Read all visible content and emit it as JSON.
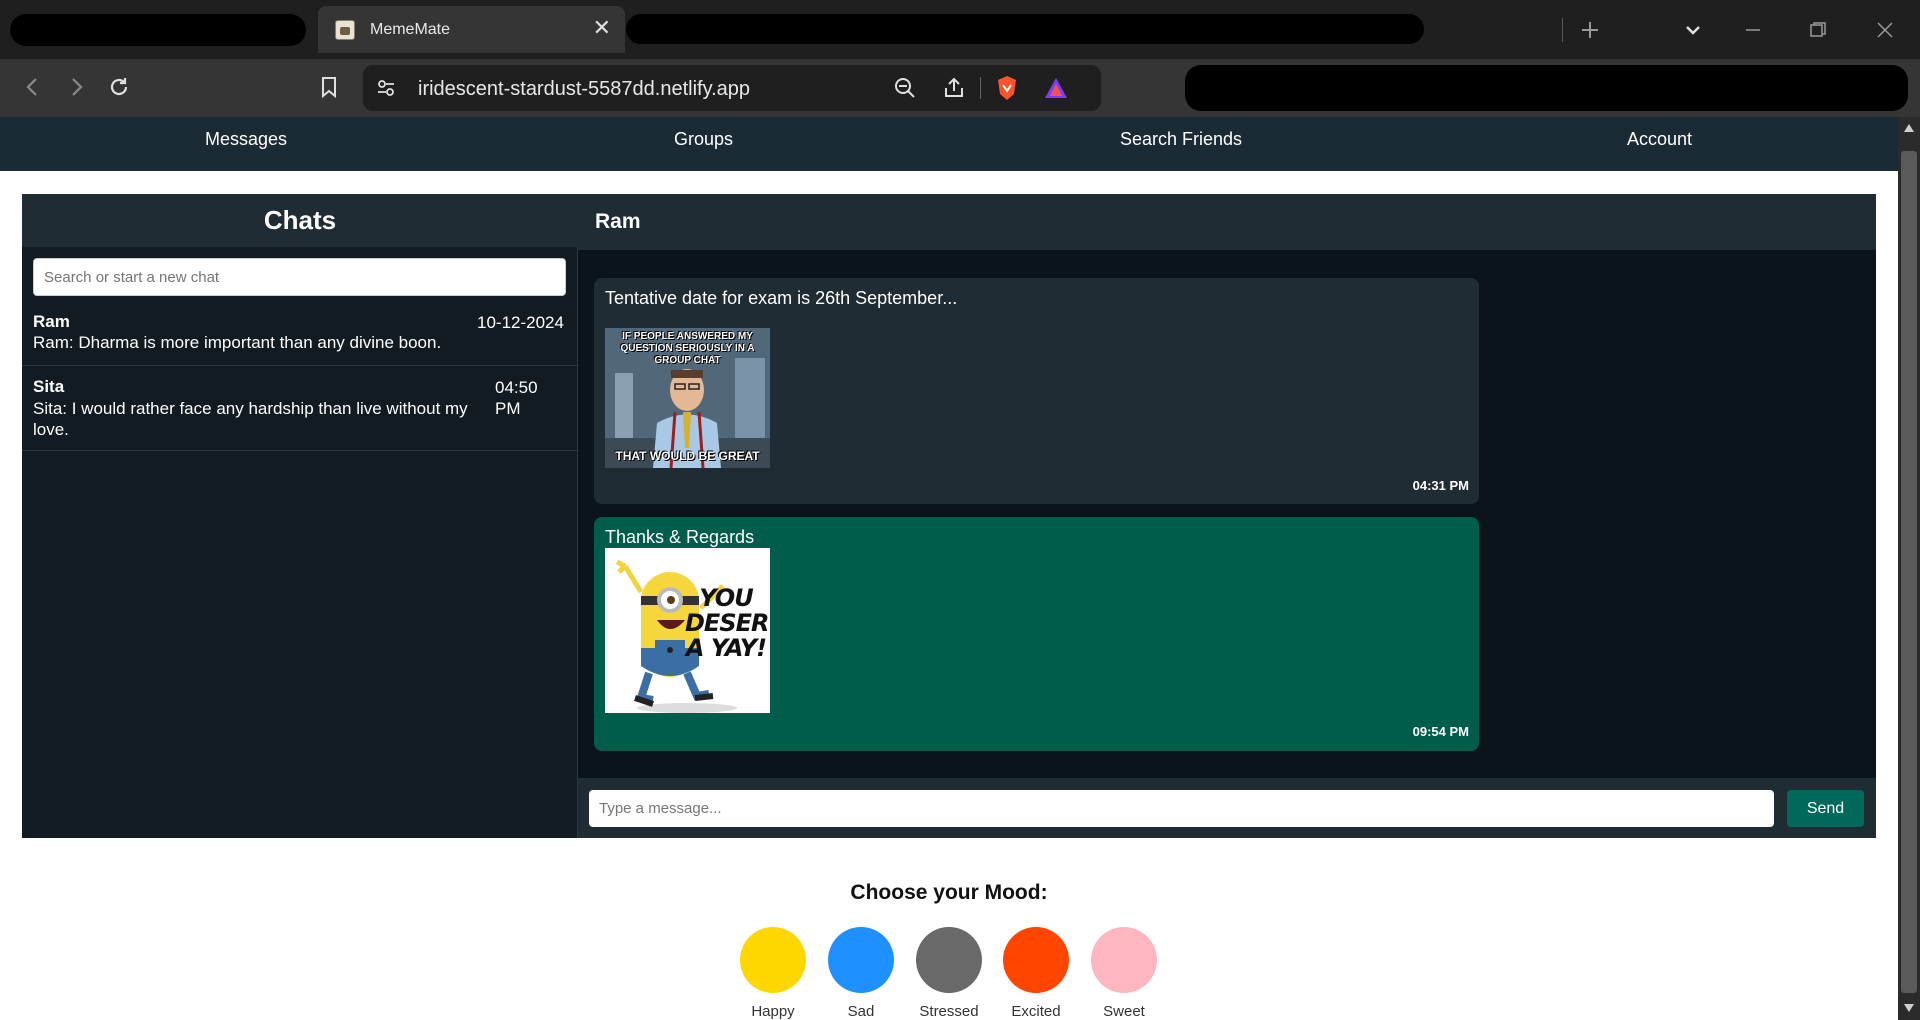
{
  "browser": {
    "tab_title": "MemeMate",
    "tab_close": "✕",
    "url": "iridescent-stardust-5587dd.netlify.app"
  },
  "nav": {
    "items": [
      "Messages",
      "Groups",
      "Search Friends",
      "Account"
    ]
  },
  "sidebar": {
    "title": "Chats",
    "search_placeholder": "Search or start a new chat",
    "chats": [
      {
        "name": "Ram",
        "preview": "Ram: Dharma is more important than any divine boon.",
        "time": "10-12-2024"
      },
      {
        "name": "Sita",
        "preview": "Sita: I would rather face any hardship than live without my love.",
        "time": "04:50 PM"
      }
    ]
  },
  "conversation": {
    "title": "Ram",
    "messages": [
      {
        "text": "Tentative date for exam is 26th September...",
        "meme_top": "IF PEOPLE ANSWERED MY QUESTION SERIOUSLY IN A GROUP CHAT",
        "meme_bottom": "THAT WOULD BE GREAT",
        "time": "04:31 PM",
        "color": "#202c33"
      },
      {
        "text": "Thanks & Regards",
        "meme_caption": "YOU DESERVE A YAY!",
        "time": "09:54 PM",
        "color": "#005c4b"
      }
    ],
    "input_placeholder": "Type a message...",
    "send_label": "Send"
  },
  "mood": {
    "title": "Choose your Mood:",
    "options": [
      {
        "label": "Happy",
        "color": "#ffd700"
      },
      {
        "label": "Sad",
        "color": "#1e90ff"
      },
      {
        "label": "Stressed",
        "color": "#696969"
      },
      {
        "label": "Excited",
        "color": "#ff4500"
      },
      {
        "label": "Sweet",
        "color": "#ffb6c1"
      }
    ]
  }
}
